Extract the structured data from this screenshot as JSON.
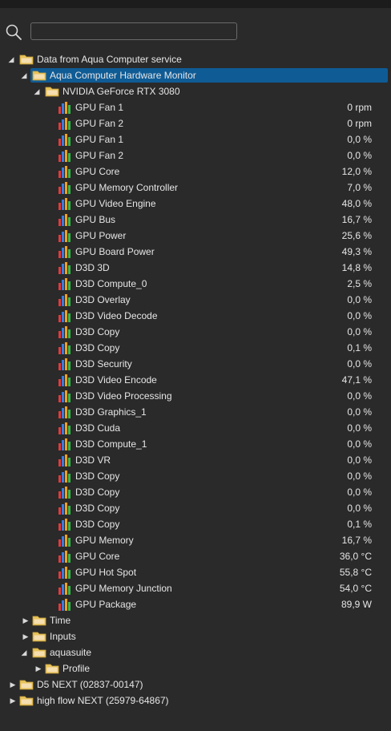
{
  "search": {
    "placeholder": ""
  },
  "tree": {
    "root": {
      "label": "Data from Aqua Computer service"
    },
    "hwmon": {
      "label": "Aqua Computer Hardware Monitor"
    },
    "gpu": {
      "label": "NVIDIA GeForce RTX 3080"
    },
    "sensors": [
      {
        "label": "GPU Fan 1",
        "value": "0 rpm"
      },
      {
        "label": "GPU Fan 2",
        "value": "0 rpm"
      },
      {
        "label": "GPU Fan 1",
        "value": "0,0 %"
      },
      {
        "label": "GPU Fan 2",
        "value": "0,0 %"
      },
      {
        "label": "GPU Core",
        "value": "12,0 %"
      },
      {
        "label": "GPU Memory Controller",
        "value": "7,0 %"
      },
      {
        "label": "GPU Video Engine",
        "value": "48,0 %"
      },
      {
        "label": "GPU Bus",
        "value": "16,7 %"
      },
      {
        "label": "GPU Power",
        "value": "25,6 %"
      },
      {
        "label": "GPU Board Power",
        "value": "49,3 %"
      },
      {
        "label": "D3D 3D",
        "value": "14,8 %"
      },
      {
        "label": "D3D Compute_0",
        "value": "2,5 %"
      },
      {
        "label": "D3D Overlay",
        "value": "0,0 %"
      },
      {
        "label": "D3D Video Decode",
        "value": "0,0 %"
      },
      {
        "label": "D3D Copy",
        "value": "0,0 %"
      },
      {
        "label": "D3D Copy",
        "value": "0,1 %"
      },
      {
        "label": "D3D Security",
        "value": "0,0 %"
      },
      {
        "label": "D3D Video Encode",
        "value": "47,1 %"
      },
      {
        "label": "D3D Video Processing",
        "value": "0,0 %"
      },
      {
        "label": "D3D Graphics_1",
        "value": "0,0 %"
      },
      {
        "label": "D3D Cuda",
        "value": "0,0 %"
      },
      {
        "label": "D3D Compute_1",
        "value": "0,0 %"
      },
      {
        "label": "D3D VR",
        "value": "0,0 %"
      },
      {
        "label": "D3D Copy",
        "value": "0,0 %"
      },
      {
        "label": "D3D Copy",
        "value": "0,0 %"
      },
      {
        "label": "D3D Copy",
        "value": "0,0 %"
      },
      {
        "label": "D3D Copy",
        "value": "0,1 %"
      },
      {
        "label": "GPU Memory",
        "value": "16,7 %"
      },
      {
        "label": "GPU Core",
        "value": "36,0 °C"
      },
      {
        "label": "GPU Hot Spot",
        "value": "55,8 °C"
      },
      {
        "label": "GPU Memory Junction",
        "value": "54,0 °C"
      },
      {
        "label": "GPU Package",
        "value": "89,9 W"
      }
    ],
    "time": {
      "label": "Time"
    },
    "inputs": {
      "label": "Inputs"
    },
    "aquasuite": {
      "label": "aquasuite"
    },
    "profile": {
      "label": "Profile"
    },
    "d5next": {
      "label": "D5 NEXT (02837-00147)"
    },
    "highflow": {
      "label": "high flow NEXT (25979-64867)"
    }
  },
  "icons": {
    "expanded": "expanded-arrow-icon",
    "collapsed": "collapsed-arrow-icon",
    "folder": "folder-icon",
    "sensor": "sensor-bars-icon",
    "search": "search-icon"
  },
  "colors": {
    "background": "#2a2a2a",
    "selection": "#0f5b95",
    "folder": "#e8c35a"
  }
}
